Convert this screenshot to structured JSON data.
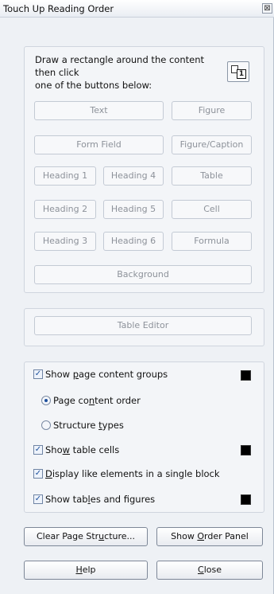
{
  "window": {
    "title": "Touch Up Reading Order",
    "close_glyph": "⊠"
  },
  "instructions": {
    "line1": "Draw a rectangle around the content then click",
    "line2": "one of the buttons below:"
  },
  "draw_tool": {
    "icon": "draw-rectangle-icon",
    "glyph": "1"
  },
  "tag_buttons": {
    "text": "Text",
    "figure": "Figure",
    "form_field": "Form Field",
    "figure_caption": "Figure/Caption",
    "heading1": "Heading 1",
    "heading4": "Heading 4",
    "table": "Table",
    "heading2": "Heading 2",
    "heading5": "Heading 5",
    "cell": "Cell",
    "heading3": "Heading 3",
    "heading6": "Heading 6",
    "formula": "Formula",
    "background": "Background"
  },
  "table_editor": {
    "label": "Table Editor"
  },
  "options": {
    "show_page_content_groups": {
      "pre": "Show ",
      "u": "p",
      "post": "age content groups",
      "checked": true
    },
    "page_content_order": {
      "pre": "Page co",
      "u": "n",
      "post": "tent order",
      "selected": true
    },
    "structure_types": {
      "pre": "Structure ",
      "u": "t",
      "post": "ypes",
      "selected": false
    },
    "show_table_cells": {
      "pre": "Sho",
      "u": "w",
      "post": " table cells",
      "checked": true
    },
    "display_like_elements": {
      "pre": "",
      "u": "D",
      "post": "isplay like elements in a single block",
      "checked": true
    },
    "show_tables_figures": {
      "pre": "Show tab",
      "u": "l",
      "post": "es and figures",
      "checked": true
    }
  },
  "colors": {
    "swatch": "#000000",
    "accent": "#1c4f9c"
  },
  "actions": {
    "clear_structure": {
      "pre": "Clear Page Str",
      "u": "u",
      "post": "cture..."
    },
    "show_order_panel": {
      "pre": "Show ",
      "u": "O",
      "post": "rder Panel"
    },
    "help": {
      "pre": "",
      "u": "H",
      "post": "elp"
    },
    "close": {
      "pre": "",
      "u": "C",
      "post": "lose"
    }
  }
}
